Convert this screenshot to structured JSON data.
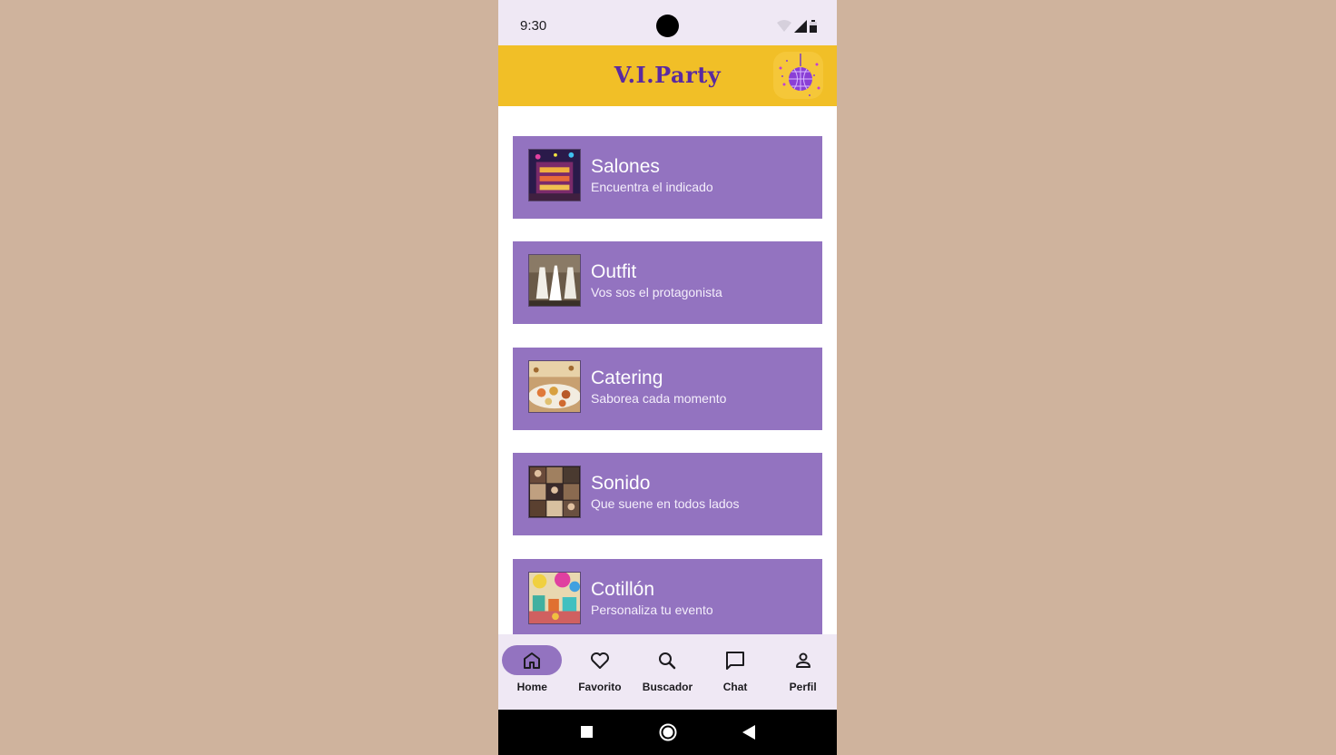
{
  "status_bar": {
    "time": "9:30"
  },
  "app": {
    "title": "V.I.Party",
    "logo_icon": "disco-ball-icon"
  },
  "categories": [
    {
      "title": "Salones",
      "subtitle": "Encuentra el indicado",
      "image": "venue-building-photo"
    },
    {
      "title": "Outfit",
      "subtitle": "Vos sos el protagonista",
      "image": "wedding-dresses-photo"
    },
    {
      "title": "Catering",
      "subtitle": "Saborea cada momento",
      "image": "banquet-table-photo"
    },
    {
      "title": "Sonido",
      "subtitle": "Que suene en todos lados",
      "image": "djs-collage-photo"
    },
    {
      "title": "Cotillón",
      "subtitle": "Personaliza tu evento",
      "image": "party-favors-photo"
    }
  ],
  "bottom_nav": [
    {
      "label": "Home",
      "icon": "home-icon",
      "active": true
    },
    {
      "label": "Favorito",
      "icon": "heart-icon",
      "active": false
    },
    {
      "label": "Buscador",
      "icon": "search-icon",
      "active": false
    },
    {
      "label": "Chat",
      "icon": "chat-icon",
      "active": false
    },
    {
      "label": "Perfil",
      "icon": "person-icon",
      "active": false
    }
  ],
  "colors": {
    "background": "#cfb39d",
    "appbar": "#f1bf27",
    "card": "#9373c0",
    "title": "#5a2aa0",
    "navbar": "#efe8f4"
  }
}
